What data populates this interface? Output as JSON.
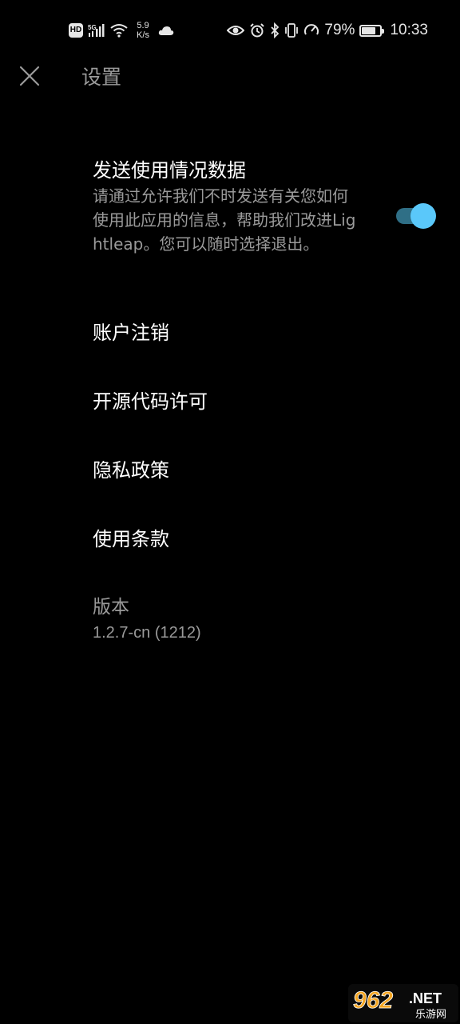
{
  "status_bar": {
    "hd_badge": "HD",
    "network_type": "5G",
    "net_speed_value": "5.9",
    "net_speed_unit": "K/s",
    "battery_percent": "79%",
    "battery_level": 0.79,
    "time": "10:33",
    "icons": [
      "hd-icon",
      "signal-icon",
      "wifi-icon",
      "cloud-icon",
      "eye-icon",
      "alarm-icon",
      "bluetooth-icon",
      "vibrate-icon",
      "speedometer-icon",
      "battery-icon"
    ]
  },
  "header": {
    "close_icon": "close-icon",
    "title": "设置"
  },
  "usage_data": {
    "title": "发送使用情况数据",
    "description": "请通过允许我们不时发送有关您如何使用此应用的信息，帮助我们改进Lightleap。您可以随时选择退出。",
    "toggle_on": true,
    "accent_color": "#5ac8fa"
  },
  "menu": {
    "account_cancel": "账户注销",
    "open_source_license": "开源代码许可",
    "privacy_policy": "隐私政策",
    "terms_of_use": "使用条款"
  },
  "version": {
    "label": "版本",
    "value": "1.2.7-cn (1212)"
  },
  "watermark": {
    "brand": "962",
    "suffix": ".NET",
    "subtitle": "乐游网"
  }
}
